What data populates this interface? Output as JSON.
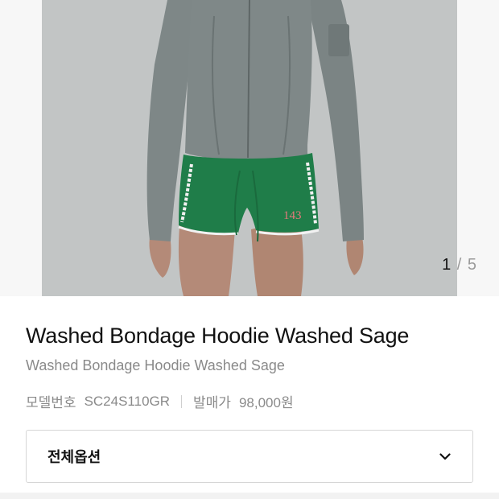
{
  "gallery": {
    "current_page": "1",
    "separator": " / ",
    "total_pages": "5",
    "image_alt": "model wearing grey zip hoodie and green shorts"
  },
  "product": {
    "title": "Washed Bondage Hoodie Washed Sage",
    "subtitle": "Washed Bondage Hoodie Washed Sage",
    "model_label": "모델번호",
    "model_number": "SC24S110GR",
    "release_price_label": "발매가",
    "release_price": "98,000원",
    "shorts_print": "143"
  },
  "options": {
    "label": "전체옵션",
    "icon": "chevron-down-icon"
  },
  "colors": {
    "background": "#ffffff",
    "photo_bg": "#c6c8c8",
    "hoodie": "#7c8585",
    "shorts": "#1f7d49"
  }
}
